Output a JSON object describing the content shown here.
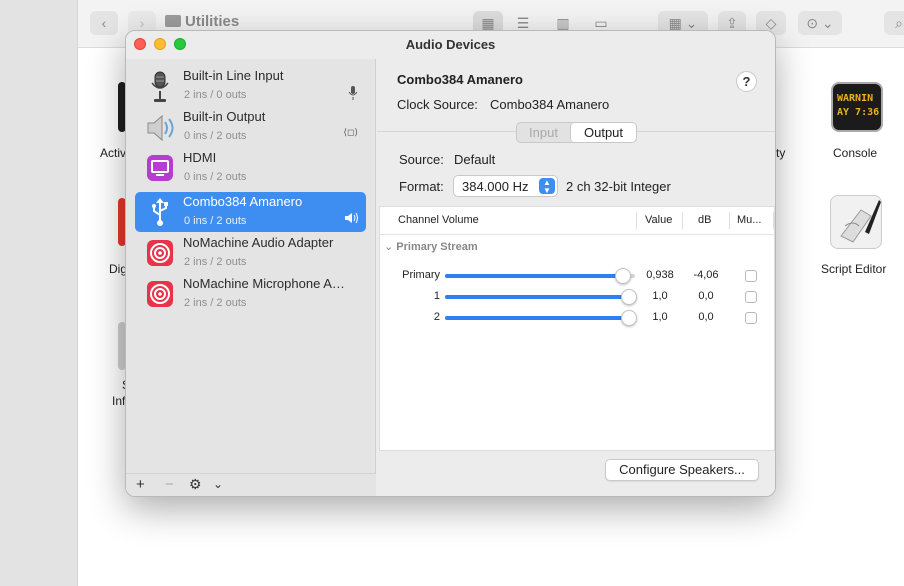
{
  "finder": {
    "title": "Utilities",
    "left_labels": [
      "Activ",
      "Dig",
      "S",
      "Inf"
    ],
    "partial_label": "ty",
    "console_label": "Console",
    "console_screen_lines": [
      "WARNIN",
      "AY 7:36"
    ],
    "script_editor_label": "Script Editor"
  },
  "window": {
    "title": "Audio Devices"
  },
  "devices": [
    {
      "name": "Built-in Line Input",
      "io": "2 ins / 0 outs",
      "icon": "microphone-icon",
      "badge": "microphone-badge-icon",
      "selected": false
    },
    {
      "name": "Built-in Output",
      "io": "0 ins / 2 outs",
      "icon": "speaker-icon",
      "badge": "alert-speaker-badge-icon",
      "selected": false
    },
    {
      "name": "HDMI",
      "io": "0 ins / 2 outs",
      "icon": "hdmi-display-icon",
      "badge": "",
      "selected": false
    },
    {
      "name": "Combo384 Amanero",
      "io": "0 ins / 2 outs",
      "icon": "usb-icon",
      "badge": "speaker-volume-badge-icon",
      "selected": true
    },
    {
      "name": "NoMachine Audio Adapter",
      "io": "2 ins / 2 outs",
      "icon": "nomachine-icon",
      "badge": "",
      "selected": false
    },
    {
      "name": "NoMachine Microphone A…",
      "io": "2 ins / 2 outs",
      "icon": "nomachine-icon",
      "badge": "",
      "selected": false
    }
  ],
  "sidebar_footer": {
    "add": "+",
    "remove": "−",
    "gear": "⚙",
    "chevron": "⌄"
  },
  "detail": {
    "device_title": "Combo384 Amanero",
    "help": "?",
    "clock_source_label": "Clock Source:",
    "clock_source_value": "Combo384 Amanero",
    "tabs": {
      "input": "Input",
      "output": "Output",
      "selected": "Output"
    },
    "source_label": "Source:",
    "source_value": "Default",
    "format_label": "Format:",
    "format_value": "384.000 Hz",
    "format_desc": "2 ch 32-bit Integer",
    "table": {
      "headers": {
        "channel": "Channel Volume",
        "value": "Value",
        "db": "dB",
        "mute": "Mu..."
      },
      "group": "Primary Stream",
      "rows": [
        {
          "label": "Primary",
          "level": 0.938,
          "value": "0,938",
          "db": "-4,06",
          "muted": false
        },
        {
          "label": "1",
          "level": 1.0,
          "value": "1,0",
          "db": "0,0",
          "muted": false
        },
        {
          "label": "2",
          "level": 1.0,
          "value": "1,0",
          "db": "0,0",
          "muted": false
        }
      ]
    },
    "configure_button": "Configure Speakers..."
  },
  "colors": {
    "accent": "#3d8ef0",
    "slider": "#2e7ff0",
    "nomachine": "#e8344a",
    "hdmi": "#b53ed1"
  }
}
